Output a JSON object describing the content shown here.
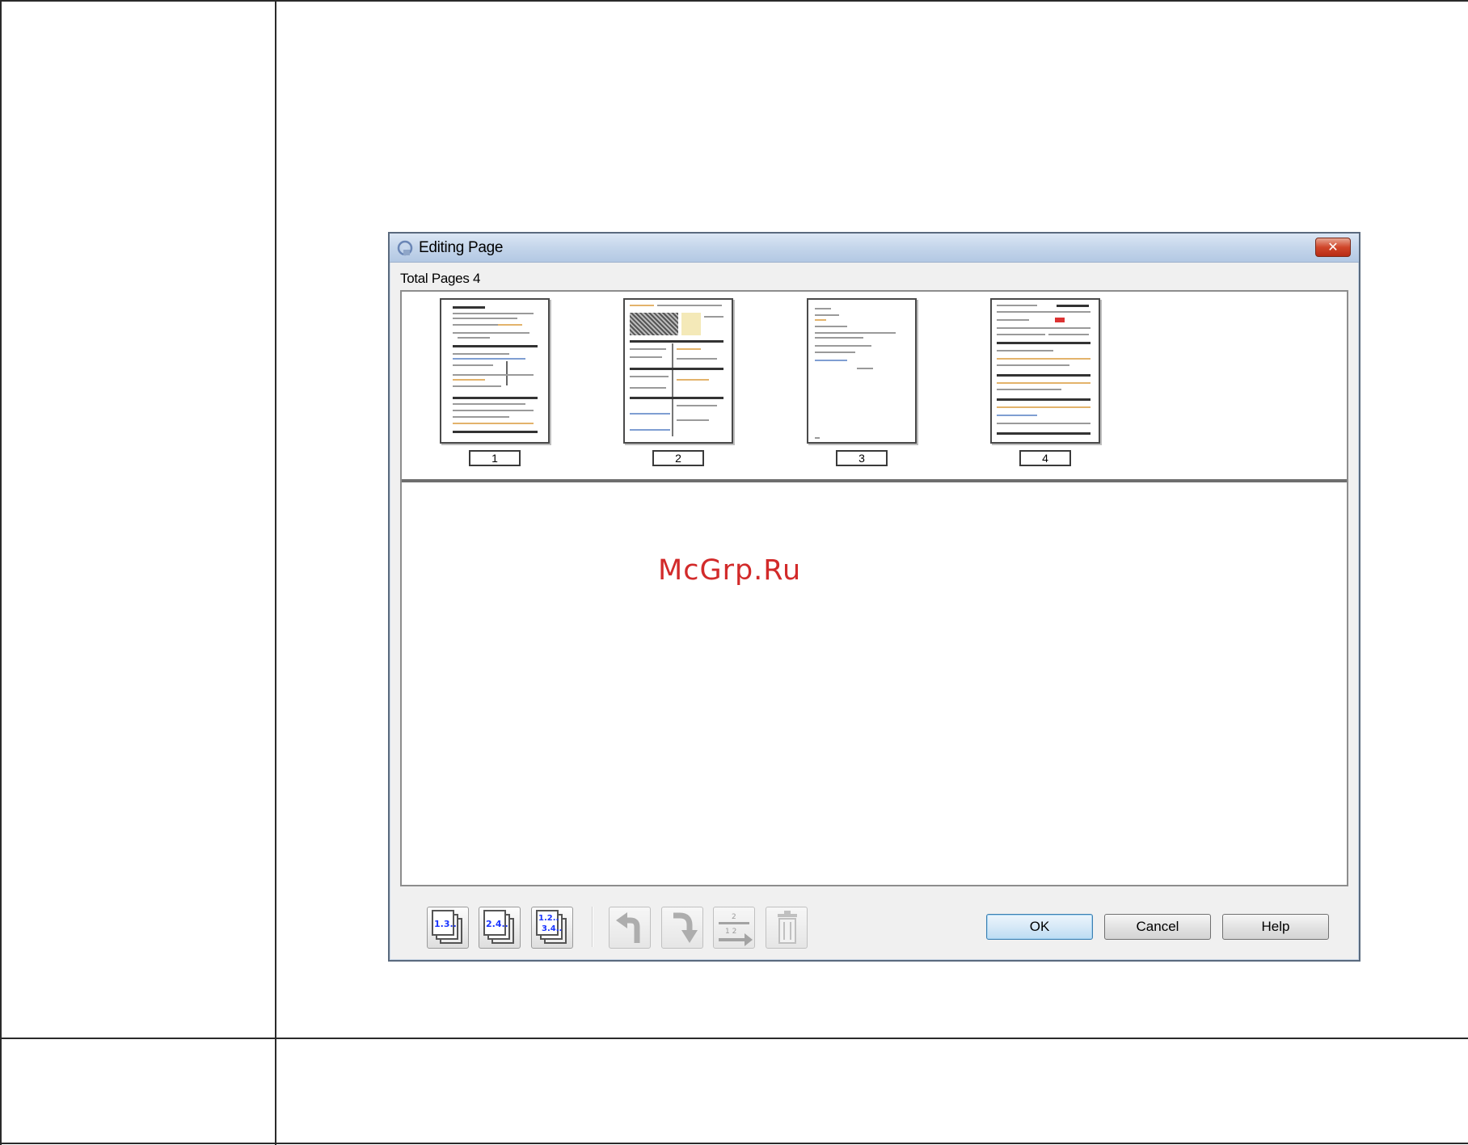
{
  "dialog": {
    "title": "Editing Page",
    "close_label": "✕",
    "total_pages_label": "Total Pages 4",
    "pages": [
      {
        "number": "1"
      },
      {
        "number": "2"
      },
      {
        "number": "3"
      },
      {
        "number": "4"
      }
    ],
    "toolbar": {
      "odd_pages_icon_text": "1.3..",
      "even_pages_icon_text": "2.4..",
      "all_pages_icon_text_top": "1.2..",
      "all_pages_icon_text_bottom": "3.4..",
      "reorder_icon_text_top": "2",
      "reorder_icon_text_bottom": "1 2"
    },
    "buttons": {
      "ok": "OK",
      "cancel": "Cancel",
      "help": "Help"
    }
  },
  "watermark": "McGrp.Ru",
  "colors": {
    "accent_blue": "#1a35ff",
    "watermark_red": "#d22a2a",
    "close_red": "#d0462a"
  }
}
